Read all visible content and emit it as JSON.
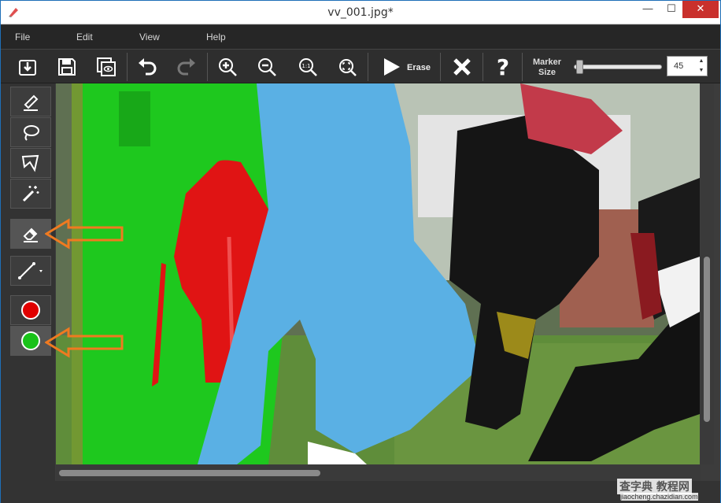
{
  "window": {
    "title": "vv_001.jpg*",
    "minimize": "—",
    "maximize": "☐",
    "close": "✕"
  },
  "menu": {
    "file": "File",
    "edit": "Edit",
    "view": "View",
    "help": "Help"
  },
  "toolbar": {
    "erase_label": "Erase",
    "marker_label_line1": "Marker",
    "marker_label_line2": "Size",
    "marker_size": "45",
    "marker_size_fraction": 0.05
  },
  "tools": [
    "marker-tool",
    "lasso-tool",
    "polygon-lasso-tool",
    "magic-wand-tool",
    "eraser-tool",
    "line-tool"
  ],
  "colors": {
    "remove": "#e00000",
    "keep": "#19c219",
    "accent_arrow": "#f07a20"
  },
  "watermark": {
    "line1": "查字典 教程网",
    "line2": "jiaocheng.chazidian.com"
  }
}
